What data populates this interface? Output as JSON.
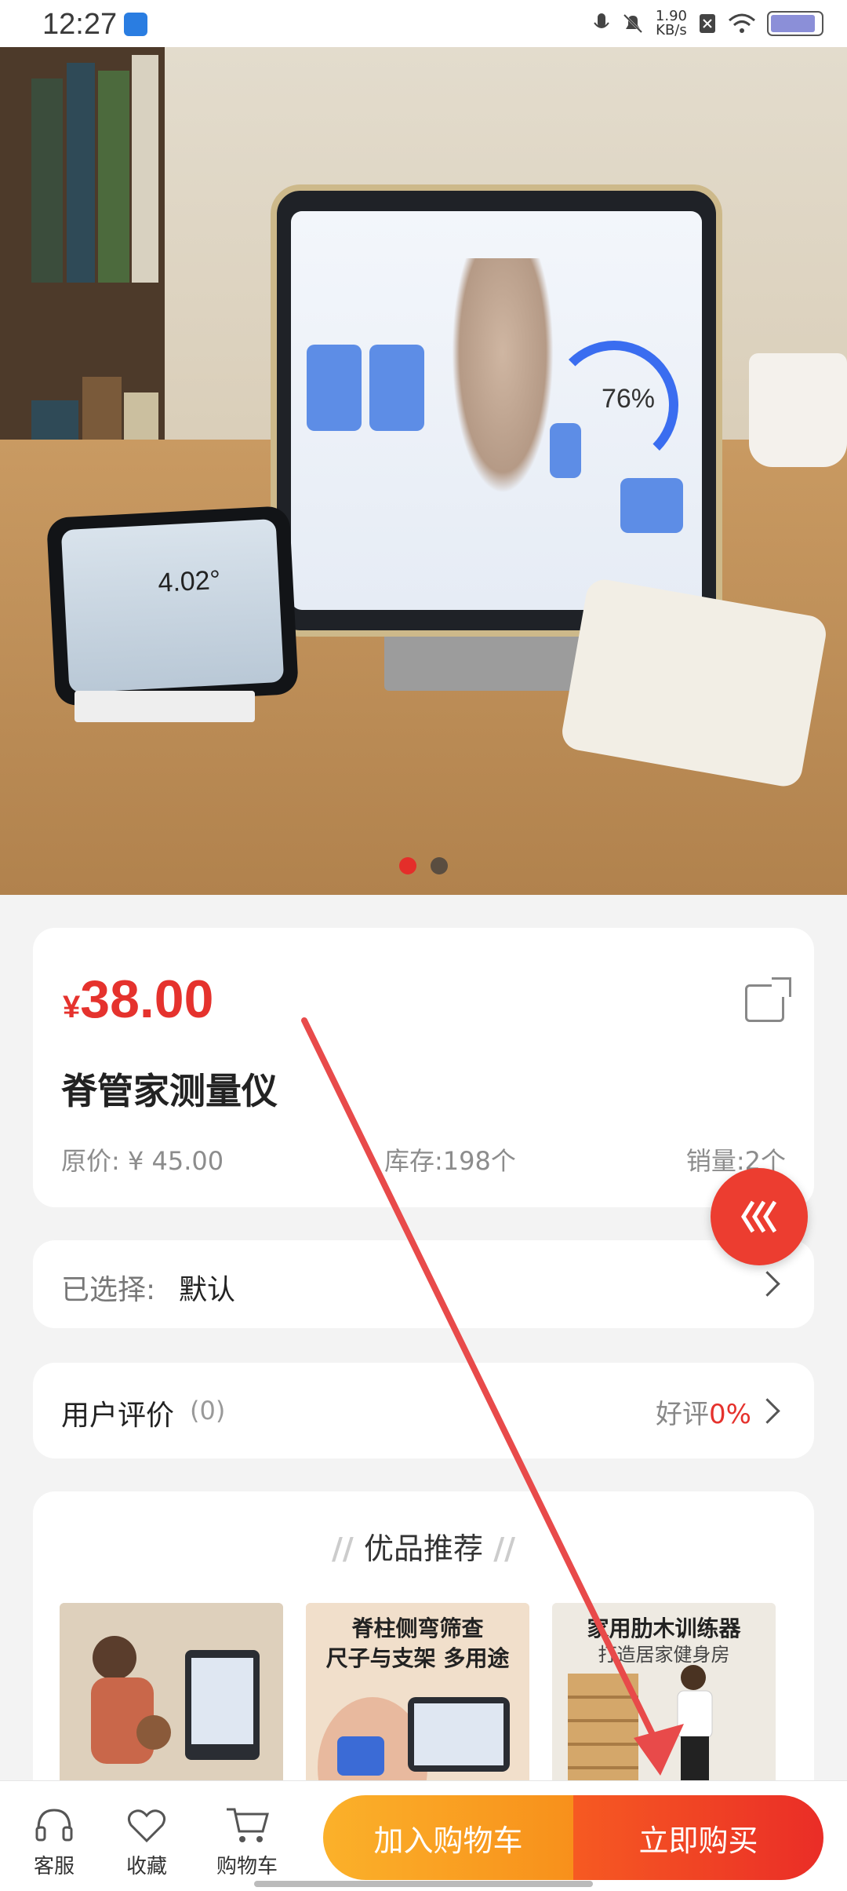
{
  "status_bar": {
    "time": "12:27",
    "speed_value": "1.90",
    "speed_unit": "KB/s"
  },
  "hero": {
    "phone_angle": "4.02°",
    "tablet_percent": "76%",
    "carousel_total": 2,
    "carousel_active": 1
  },
  "product": {
    "currency": "¥",
    "price": "38.00",
    "name": "脊管家测量仪",
    "original_price": "原价: ¥ 45.00",
    "stock": "库存:198个",
    "sales": "销量:2个"
  },
  "selection": {
    "label": "已选择:",
    "value": "默认"
  },
  "reviews": {
    "label": "用户评价",
    "count": "(0)",
    "good_label": "好评",
    "good_value": "0%"
  },
  "recommend": {
    "title": "优品推荐",
    "items": [
      {
        "caption_line1": "",
        "caption_line2": ""
      },
      {
        "caption_line1": "脊柱侧弯筛查",
        "caption_line2": "尺子与支架 多用途"
      },
      {
        "caption_line1": "家用肋木训练器",
        "caption_line2": "打造居家健身房"
      }
    ]
  },
  "bottom_bar": {
    "service": "客服",
    "favorite": "收藏",
    "cart": "购物车",
    "add_to_cart": "加入购物车",
    "buy_now": "立即购买"
  },
  "colors": {
    "price_red": "#e5322d",
    "cart_orange": "#f8901b",
    "buy_red": "#ea2d27"
  }
}
